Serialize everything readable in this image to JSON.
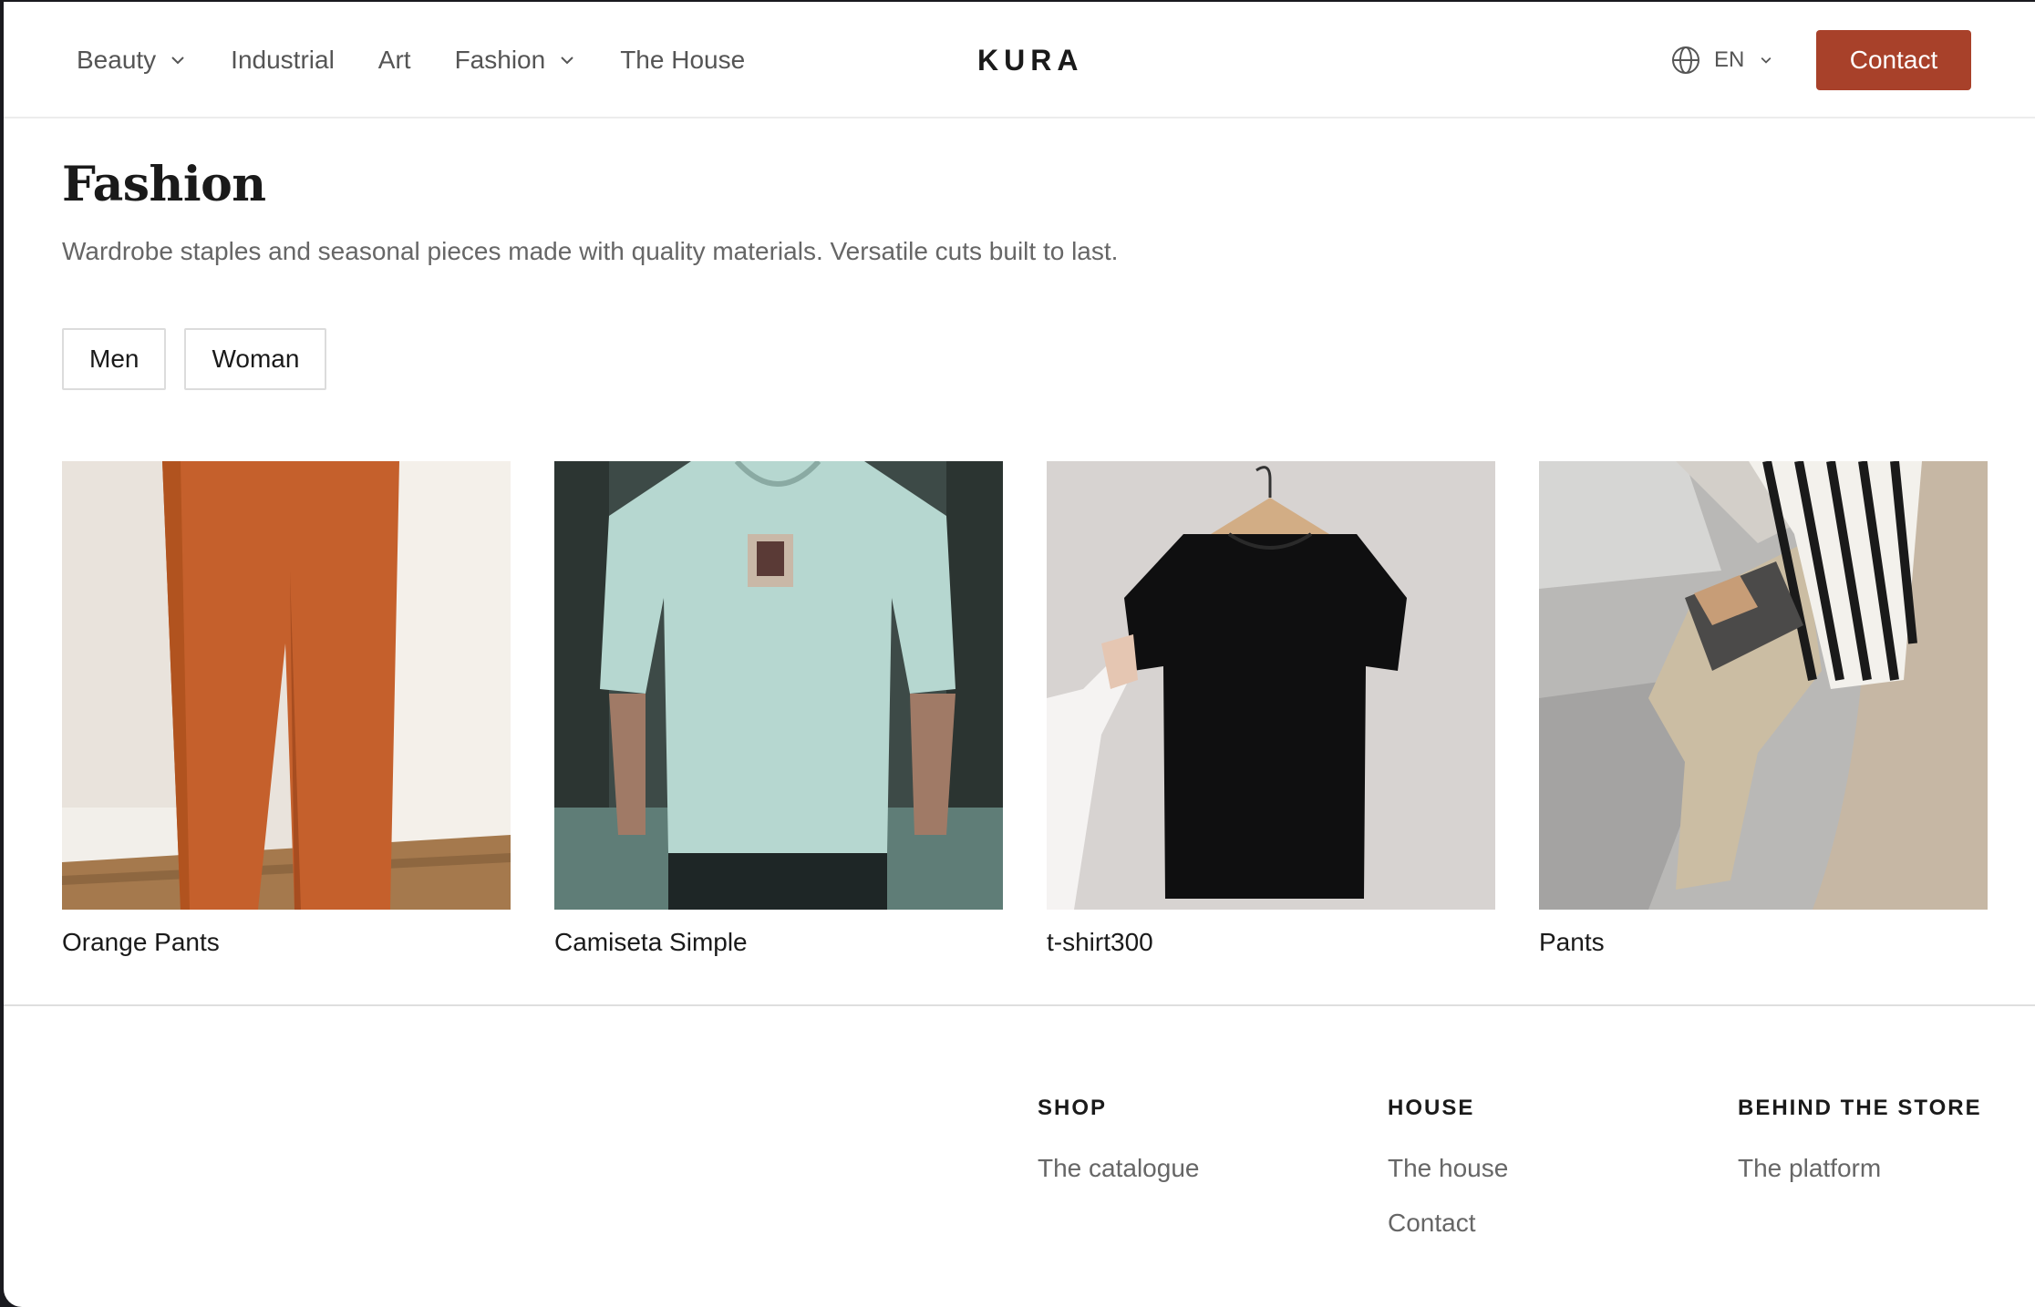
{
  "nav": {
    "items": [
      {
        "label": "Beauty",
        "has_dropdown": true
      },
      {
        "label": "Industrial",
        "has_dropdown": false
      },
      {
        "label": "Art",
        "has_dropdown": false
      },
      {
        "label": "Fashion",
        "has_dropdown": true
      },
      {
        "label": "The House",
        "has_dropdown": false
      }
    ],
    "logo": "KURA",
    "language": "EN",
    "contact_label": "Contact"
  },
  "main": {
    "title": "Fashion",
    "description": "Wardrobe staples and seasonal pieces made with quality materials. Versatile cuts built to last.",
    "filters": [
      "Men",
      "Woman"
    ],
    "products": [
      {
        "name": "Orange Pants"
      },
      {
        "name": "Camiseta Simple"
      },
      {
        "name": "t-shirt300"
      },
      {
        "name": "Pants"
      }
    ]
  },
  "footer": {
    "shop": {
      "heading": "SHOP",
      "links": [
        "The catalogue"
      ]
    },
    "house": {
      "heading": "HOUSE",
      "links": [
        "The house",
        "Contact"
      ]
    },
    "behind": {
      "heading": "BEHIND THE STORE",
      "links": [
        "The platform"
      ]
    }
  },
  "colors": {
    "accent": "#a8412a",
    "text": "#1a1a1a",
    "muted": "#666666"
  }
}
